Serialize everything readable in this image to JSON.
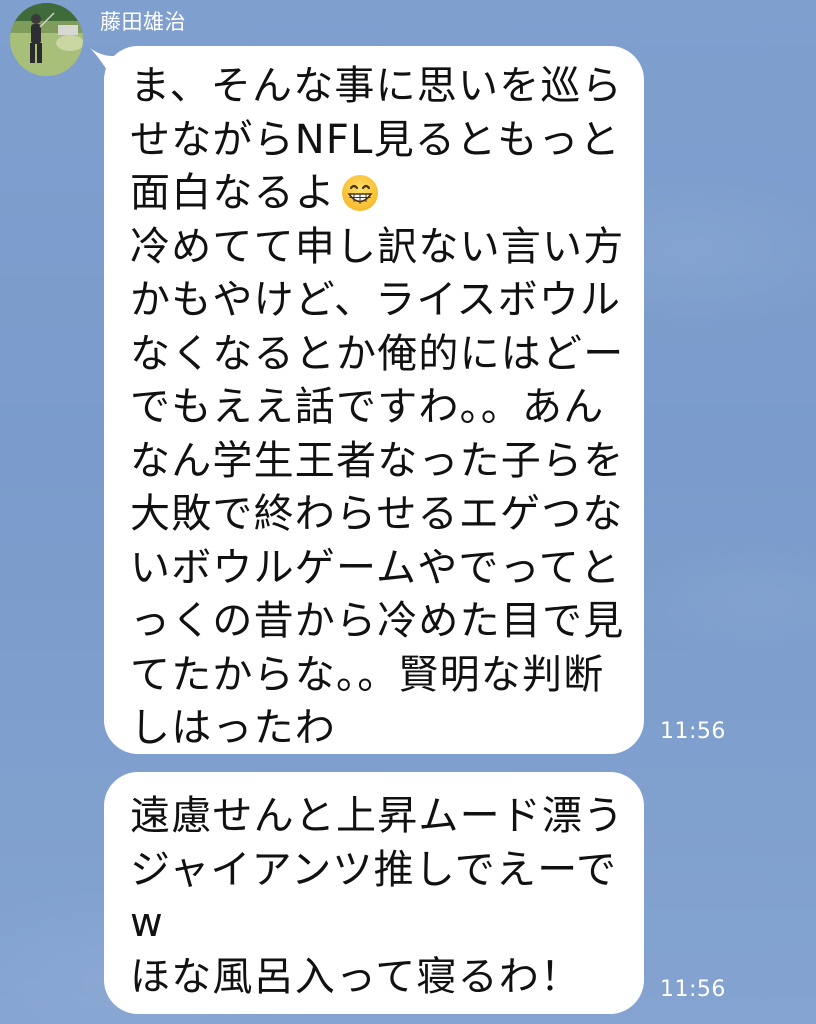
{
  "chat": {
    "sender": {
      "name": "藤田雄治",
      "avatar_icon": "avatar-golfer-photo-icon"
    },
    "messages": [
      {
        "lines": [
          "ま、そんな事に思いを巡ら",
          "せながらNFL見るともっと",
          "面白なるよ",
          "冷めてて申し訳ない言い方",
          "かもやけど、ライスボウル",
          "なくなるとか俺的にはどー",
          "でもええ話ですわ。。あん",
          "なん学生王者なった子らを",
          "大敗で終わらせるエゲつな",
          "いボウルゲームやでってと",
          "っくの昔から冷めた目で見",
          "てたからな。。賢明な判断",
          "しはったわ"
        ],
        "emoji_icon": "grinning-face-emoji-icon",
        "time": "11:56"
      },
      {
        "lines": [
          "遠慮せんと上昇ムード漂う",
          "ジャイアンツ推しでえーで",
          "w",
          "ほな風呂入って寝るわ！"
        ],
        "time": "11:56"
      }
    ]
  },
  "colors": {
    "background": "#7f9fcf",
    "bubble": "#ffffff",
    "text": "#111111",
    "timestamp": "#ffffff"
  }
}
